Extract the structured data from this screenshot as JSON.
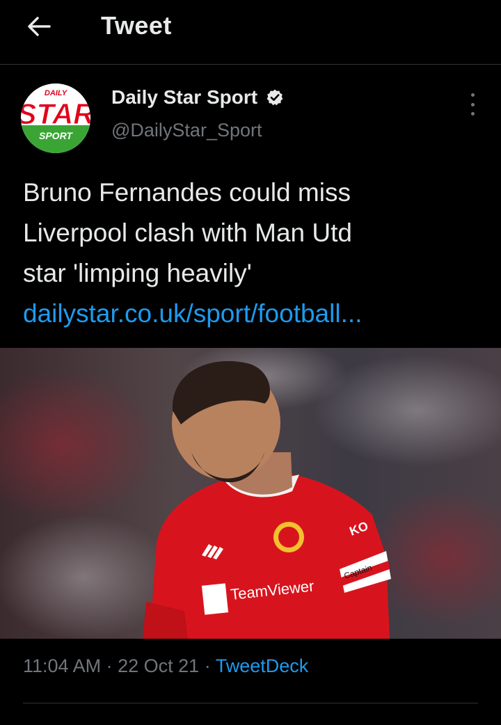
{
  "header": {
    "title": "Tweet",
    "back_icon": "arrow-left-icon"
  },
  "author": {
    "display_name": "Daily Star Sport",
    "handle": "@DailyStar_Sport",
    "verified": true,
    "avatar_text": {
      "top": "DAILY",
      "main": "STAR",
      "bottom": "SPORT"
    },
    "brand_colors": {
      "red": "#e2001a",
      "green": "#3aa535"
    }
  },
  "tweet": {
    "text_lines": [
      "Bruno Fernandes could miss",
      "Liverpool clash with Man Utd",
      "star 'limping heavily'"
    ],
    "link": "dailystar.co.uk/sport/football...",
    "media": {
      "kit_sponsor": "TeamViewer",
      "armband": "Captain",
      "sleeve": "KO",
      "shirt_color": "#d7141d"
    },
    "time": "11:04 AM",
    "separator": "·",
    "date": "22 Oct 21",
    "source": "TweetDeck"
  },
  "colors": {
    "background": "#000000",
    "text": "#e7e9ea",
    "secondary": "#71767b",
    "link": "#1d9bf0",
    "divider": "#2f3336"
  }
}
